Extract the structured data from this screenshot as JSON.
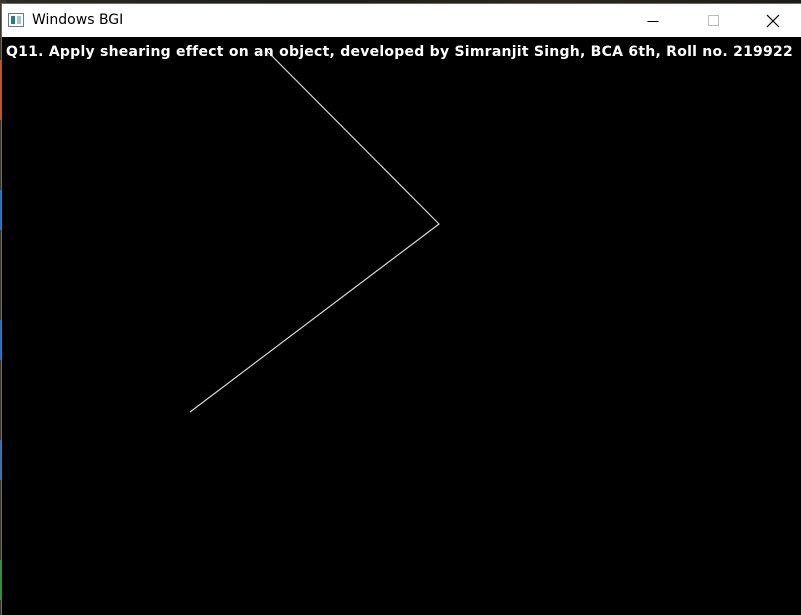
{
  "window": {
    "title": "Windows BGI",
    "icon": "app-window-icon",
    "controls": {
      "minimize_icon": "minimize-icon",
      "maximize_icon": "maximize-icon",
      "close_icon": "close-icon"
    }
  },
  "canvas": {
    "background": "#000000",
    "caption": "Q11. Apply shearing effect on an object, developed by Simranjit Singh, BCA 6th, Roll no. 219922",
    "line_color": "#ffffff"
  }
}
